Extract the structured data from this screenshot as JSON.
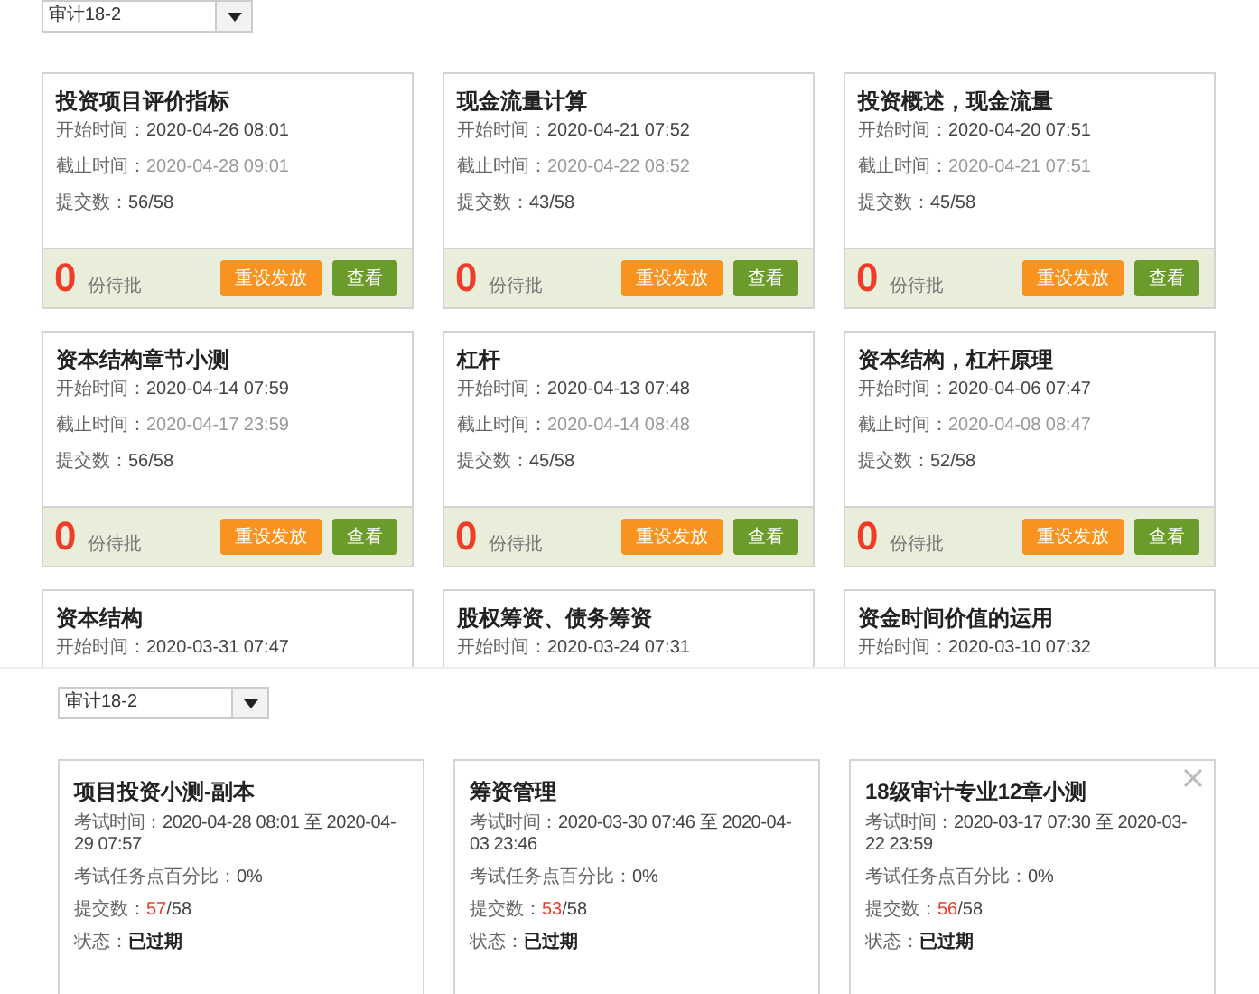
{
  "top_panel": {
    "class_select": {
      "value": "审计18-2"
    },
    "cards": [
      {
        "title": "投资项目评价指标",
        "start_label": "开始时间：",
        "start": "2020-04-26 08:01",
        "end_label": "截止时间：",
        "end": "2020-04-28 09:01",
        "submitted_label": "提交数：",
        "submitted": "56/58",
        "pending": "0",
        "pending_label": "份待批",
        "buttons": [
          "重设发放",
          "查看"
        ]
      },
      {
        "title": "现金流量计算",
        "start_label": "开始时间：",
        "start": "2020-04-21 07:52",
        "end_label": "截止时间：",
        "end": "2020-04-22 08:52",
        "submitted_label": "提交数：",
        "submitted": "43/58",
        "pending": "0",
        "pending_label": "份待批",
        "buttons": [
          "重设发放",
          "查看"
        ]
      },
      {
        "title": "投资概述，现金流量",
        "start_label": "开始时间：",
        "start": "2020-04-20 07:51",
        "end_label": "截止时间：",
        "end": "2020-04-21 07:51",
        "submitted_label": "提交数：",
        "submitted": "45/58",
        "pending": "0",
        "pending_label": "份待批",
        "buttons": [
          "重设发放",
          "查看"
        ]
      },
      {
        "title": "资本结构章节小测",
        "start_label": "开始时间：",
        "start": "2020-04-14 07:59",
        "end_label": "截止时间：",
        "end": "2020-04-17 23:59",
        "submitted_label": "提交数：",
        "submitted": "56/58",
        "pending": "0",
        "pending_label": "份待批",
        "buttons": [
          "重设发放",
          "查看"
        ]
      },
      {
        "title": "杠杆",
        "start_label": "开始时间：",
        "start": "2020-04-13 07:48",
        "end_label": "截止时间：",
        "end": "2020-04-14 08:48",
        "submitted_label": "提交数：",
        "submitted": "45/58",
        "pending": "0",
        "pending_label": "份待批",
        "buttons": [
          "重设发放",
          "查看"
        ]
      },
      {
        "title": "资本结构，杠杆原理",
        "start_label": "开始时间：",
        "start": "2020-04-06 07:47",
        "end_label": "截止时间：",
        "end": "2020-04-08 08:47",
        "submitted_label": "提交数：",
        "submitted": "52/58",
        "pending": "0",
        "pending_label": "份待批",
        "buttons": [
          "重设发放",
          "查看"
        ]
      },
      {
        "title": "资本结构",
        "start_label": "开始时间：",
        "start": "2020-03-31 07:47"
      },
      {
        "title": "股权筹资、债务筹资",
        "start_label": "开始时间：",
        "start": "2020-03-24 07:31"
      },
      {
        "title": "资金时间价值的运用",
        "start_label": "开始时间：",
        "start": "2020-03-10 07:32"
      }
    ]
  },
  "bottom_panel": {
    "class_select": {
      "value": "审计18-2"
    },
    "cards": [
      {
        "title": "项目投资小测-副本",
        "time_label": "考试时间：",
        "time": "2020-04-28 08:01 至 2020-04-29 07:57",
        "percent_label": "考试任务点百分比：",
        "percent": "0%",
        "submitted_label": "提交数：",
        "submitted_done": "57",
        "submitted_total": "/58",
        "status_label": "状态：",
        "status": "已过期",
        "closable": false
      },
      {
        "title": "筹资管理",
        "time_label": "考试时间：",
        "time": "2020-03-30 07:46 至 2020-04-03 23:46",
        "percent_label": "考试任务点百分比：",
        "percent": "0%",
        "submitted_label": "提交数：",
        "submitted_done": "53",
        "submitted_total": "/58",
        "status_label": "状态：",
        "status": "已过期",
        "closable": false
      },
      {
        "title": "18级审计专业12章小测",
        "time_label": "考试时间：",
        "time": "2020-03-17 07:30 至 2020-03-22 23:59",
        "percent_label": "考试任务点百分比：",
        "percent": "0%",
        "submitted_label": "提交数：",
        "submitted_done": "56",
        "submitted_total": "/58",
        "status_label": "状态：",
        "status": "已过期",
        "closable": true
      }
    ]
  }
}
